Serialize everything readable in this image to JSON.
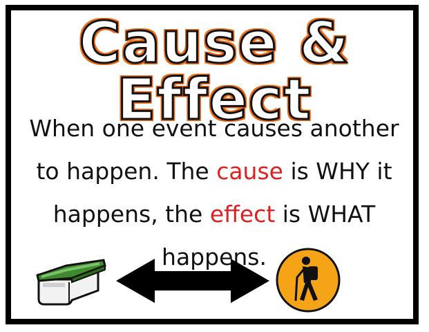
{
  "title": "Cause & Effect",
  "definition": {
    "line1": "When one event causes another",
    "line2_a": "to happen. The ",
    "line2_cause": "cause",
    "line2_b": " is WHY it",
    "line3_a": "happens, the ",
    "line3_effect": "effect",
    "line3_b": " is WHAT",
    "line4": "happens."
  },
  "icons": {
    "left": "box-icon",
    "middle": "double-arrow-icon",
    "right": "hiker-icon"
  },
  "colors": {
    "frame": "#000000",
    "title_outline": "#ee6a12",
    "highlight": "#e02020",
    "hiker_circle": "#f4a416",
    "box_lid": "#3f8a2e"
  }
}
